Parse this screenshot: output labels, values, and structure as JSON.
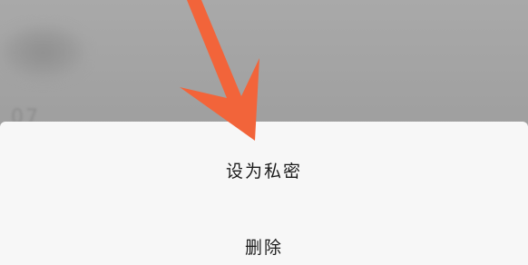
{
  "background": {
    "blurred_text": "07"
  },
  "action_sheet": {
    "items": [
      {
        "label": "设为私密"
      },
      {
        "label": "删除"
      }
    ]
  },
  "colors": {
    "overlay": "#a3a3a3",
    "sheet": "#f7f7f7",
    "text": "#1b1b1b",
    "annotation_arrow": "#f2643a"
  },
  "annotation": {
    "icon": "arrow-down-icon"
  }
}
